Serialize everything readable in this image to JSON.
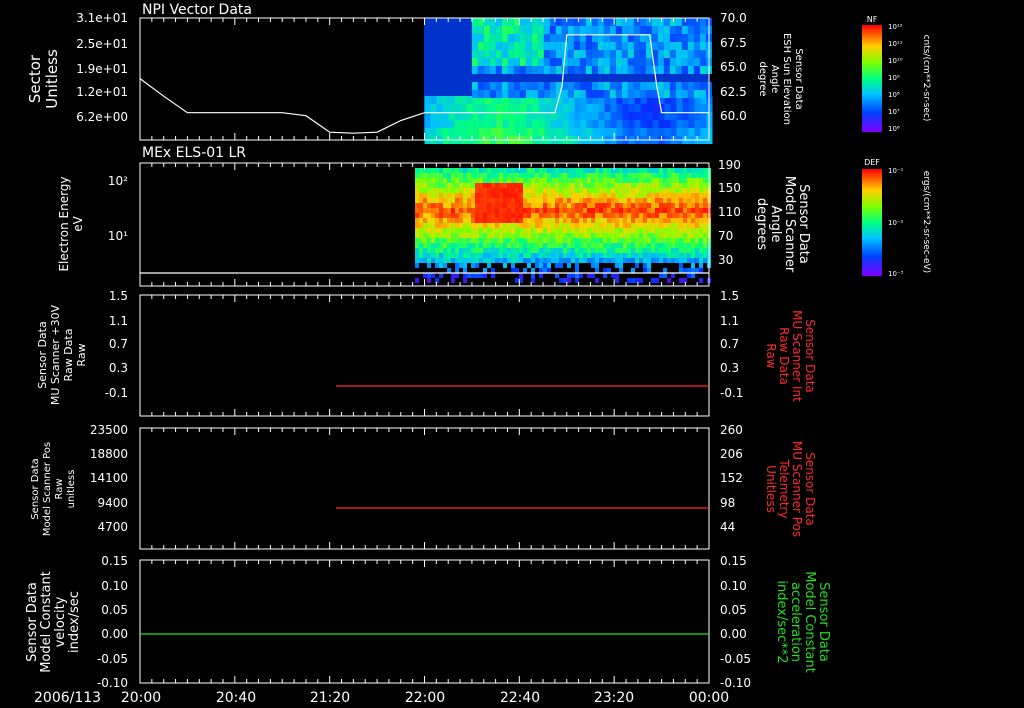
{
  "date_label": "2006/113",
  "time_ticks": [
    "20:00",
    "20:40",
    "21:20",
    "22:00",
    "22:40",
    "23:20",
    "00:00"
  ],
  "panels": [
    {
      "title": "NPI Vector Data",
      "left_label": [
        "Sector",
        "Unitless"
      ],
      "left_ticks": [
        "3.1e+01",
        "2.5e+01",
        "1.9e+01",
        "1.2e+01",
        "6.2e+00"
      ],
      "right_label": [
        "Sensor Data",
        "ESH Sun Elevation",
        "Angle",
        "degree"
      ],
      "right_ticks": [
        "70.0",
        "67.5",
        "65.0",
        "62.5",
        "60.0"
      ],
      "colorbar": {
        "label": "NF",
        "unit": "cnts/(cm**2-sr-sec)",
        "ticks": [
          "10¹²",
          "10¹¹",
          "10¹⁰",
          "10⁹",
          "10⁸",
          "10⁷",
          "10⁶"
        ]
      }
    },
    {
      "title": "MEx ELS-01 LR",
      "left_label": [
        "Electron Energy",
        "eV"
      ],
      "left_ticks": [
        "10²",
        "10¹"
      ],
      "right_label": [
        "Sensor Data",
        "Model Scanner",
        "Angle",
        "degrees"
      ],
      "right_ticks": [
        "190",
        "150",
        "110",
        "70",
        "30"
      ],
      "colorbar": {
        "label": "DEF",
        "unit": "ergs/(cm**2-sr-sec-eV)",
        "ticks": [
          "10⁻¹",
          "10⁻²",
          "10⁻³"
        ]
      }
    },
    {
      "title": "",
      "left_label": [
        "Sensor Data",
        "MU Scanner +30V",
        "Raw Data",
        "Raw"
      ],
      "left_ticks": [
        "1.5",
        "1.1",
        "0.7",
        "0.3",
        "-0.1"
      ],
      "right_label": [
        "Sensor Data",
        "MU Scanner Int",
        "Raw Data",
        "Raw"
      ],
      "right_ticks": [
        "1.5",
        "1.1",
        "0.7",
        "0.3",
        "-0.1"
      ]
    },
    {
      "title": "",
      "left_label": [
        "Sensor Data",
        "Model Scanner Pos",
        "Raw",
        "unitless"
      ],
      "left_ticks": [
        "23500",
        "18800",
        "14100",
        "9400",
        "4700"
      ],
      "right_label": [
        "Sensor Data",
        "MU Scanner Pos",
        "Telemetry",
        "Unitless"
      ],
      "right_ticks": [
        "260",
        "206",
        "152",
        "98",
        "44"
      ]
    },
    {
      "title": "",
      "left_label": [
        "Sensor Data",
        "Model Constant",
        "velocity",
        "index/sec"
      ],
      "left_ticks": [
        "0.15",
        "0.10",
        "0.05",
        "0.00",
        "-0.05",
        "-0.10"
      ],
      "right_label": [
        "Sensor Data",
        "Model Constant",
        "acceleration",
        "index/sec**2"
      ],
      "right_ticks": [
        "0.15",
        "0.10",
        "0.05",
        "0.00",
        "-0.05",
        "-0.10"
      ]
    }
  ],
  "colors": {
    "background": "#000000",
    "axes": "#ffffff",
    "red_trace": "#ff2a2a",
    "green_trace": "#22dd22"
  },
  "chart_data": [
    {
      "type": "heatmap",
      "title": "NPI Vector Data",
      "x_range": [
        "20:00",
        "00:00"
      ],
      "ylabel": "Sector Unitless",
      "y2label": "Sensor Data ESH Sun Elevation Angle degree",
      "y2lim": [
        58.5,
        70.0
      ],
      "data_start": "22:00",
      "overlay_line": {
        "name": "ESH Sun Elevation Angle",
        "x": [
          "20:00",
          "20:10",
          "20:20",
          "20:40",
          "21:00",
          "21:10",
          "21:20",
          "21:30",
          "21:40",
          "21:50",
          "22:00",
          "22:20",
          "22:40",
          "22:55",
          "22:58",
          "23:00",
          "23:20",
          "23:35",
          "23:38",
          "23:40",
          "24:00"
        ],
        "y": [
          64.8,
          63.0,
          61.3,
          61.3,
          61.3,
          61.0,
          59.3,
          59.2,
          59.3,
          60.5,
          61.3,
          61.3,
          61.3,
          61.3,
          64.0,
          69.3,
          69.3,
          69.3,
          64.0,
          61.3,
          61.3
        ]
      }
    },
    {
      "type": "heatmap",
      "title": "MEx ELS-01 LR",
      "x_range": [
        "20:00",
        "00:00"
      ],
      "ylabel": "Electron Energy eV",
      "yscale": "log",
      "y2label": "Sensor Data Model Scanner Angle degrees",
      "data_start": "21:56",
      "overlay_line": {
        "name": "Model Scanner Angle",
        "x": [
          "20:00",
          "00:00"
        ],
        "y": [
          10,
          10
        ]
      }
    },
    {
      "type": "line",
      "ylabel": "Sensor Data MU Scanner +30V Raw Data Raw",
      "y2label": "Sensor Data MU Scanner Int Raw Data Raw",
      "ylim": [
        -0.3,
        1.5
      ],
      "series": [
        {
          "x": [
            "21:22",
            "00:00"
          ],
          "y": [
            0.0,
            0.0
          ],
          "color": "#ff2a2a"
        }
      ]
    },
    {
      "type": "line",
      "ylabel": "Sensor Data Model Scanner Pos Raw unitless",
      "y2label": "Sensor Data MU Scanner Pos Telemetry Unitless",
      "ylim": [
        0,
        23500
      ],
      "y2lim": [
        0,
        260
      ],
      "series": [
        {
          "x": [
            "21:22",
            "00:00"
          ],
          "y": [
            9400,
            9400
          ],
          "color": "#ff2a2a"
        }
      ]
    },
    {
      "type": "line",
      "ylabel": "Sensor Data Model Constant velocity index/sec",
      "y2label": "Sensor Data Model Constant acceleration index/sec**2",
      "ylim": [
        -0.1,
        0.15
      ],
      "series": [
        {
          "x": [
            "20:00",
            "00:00"
          ],
          "y": [
            0.0,
            0.0
          ],
          "color": "#22dd22"
        }
      ]
    }
  ]
}
